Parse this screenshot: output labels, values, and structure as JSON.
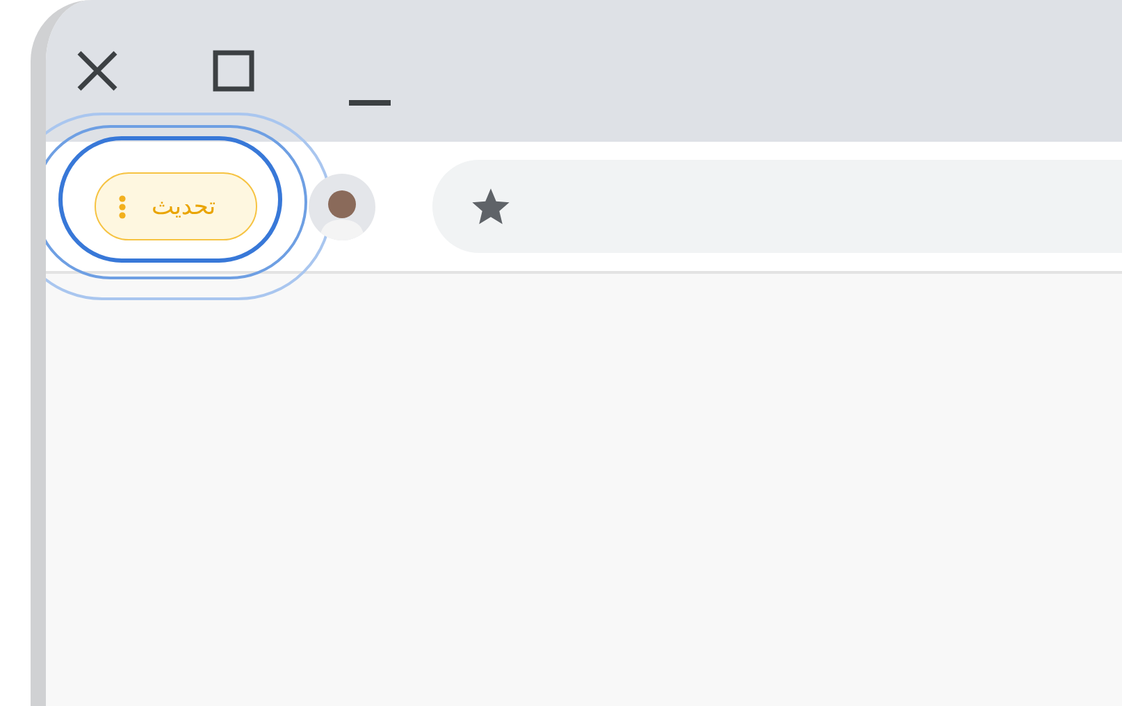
{
  "toolbar": {
    "update_button": {
      "label": "تحديث",
      "focused": true
    }
  }
}
